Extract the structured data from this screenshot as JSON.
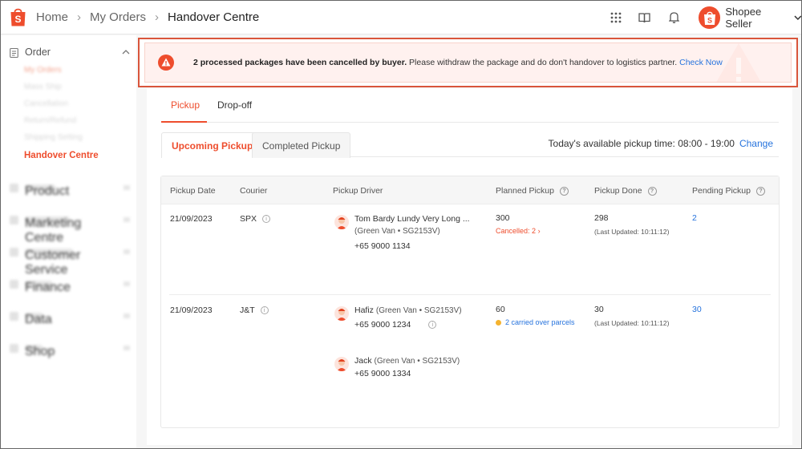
{
  "header": {
    "breadcrumbs": [
      "Home",
      "My Orders",
      "Handover Centre"
    ],
    "seller_name": "Shopee Seller",
    "icons": [
      "apps-grid-icon",
      "book-icon",
      "bell-icon",
      "chevron-down-icon"
    ]
  },
  "sidebar": {
    "section_label": "Order",
    "sub_items": [
      "My Orders",
      "Mass Ship",
      "Cancellation",
      "Return/Refund",
      "Shipping Setting"
    ],
    "active_item": "Handover Centre",
    "collapsed_groups": [
      "Product",
      "Marketing Centre",
      "Customer Service",
      "Finance",
      "Data",
      "Shop"
    ]
  },
  "alert": {
    "bold": "2 processed packages have been cancelled by buyer.",
    "text": " Please withdraw the package and do don't handover to logistics partner. ",
    "link": "Check Now"
  },
  "tabs": [
    "Pickup",
    "Drop-off"
  ],
  "subtabs": [
    "Upcoming Pickup",
    "Completed Pickup"
  ],
  "pickup_time": {
    "text": "Today's available pickup time: 08:00 - 19:00",
    "change": "Change"
  },
  "table": {
    "columns": [
      "Pickup Date",
      "Courier",
      "Pickup Driver",
      "Planned Pickup",
      "Pickup Done",
      "Pending Pickup"
    ],
    "rows": [
      {
        "date": "21/09/2023",
        "courier": "SPX",
        "driver1_name": "Tom Bardy Lundy Very Long ...",
        "driver1_vehicle": "(Green Van • SG2153V)",
        "driver1_phone": "+65 9000 1134",
        "planned": "300",
        "planned_note": "Cancelled: 2",
        "done": "298",
        "done_note": "(Last Updated: 10:11:12)",
        "pending": "2"
      },
      {
        "date": "21/09/2023",
        "courier": "J&T",
        "driver1_name": "Hafiz",
        "driver1_vehicle": "(Green Van • SG2153V)",
        "driver1_phone": "+65 9000 1234",
        "driver2_name": "Jack",
        "driver2_vehicle": "(Green Van • SG2153V)",
        "driver2_phone": "+65 9000 1334",
        "planned": "60",
        "planned_note": "2 carried over parcels",
        "done": "30",
        "done_note": "(Last Updated: 10:11:12)",
        "pending": "30"
      }
    ]
  },
  "colors": {
    "brand": "#ee4d2d",
    "link": "#2673dd",
    "alert_bg": "#fff1ef",
    "alert_outline": "#d9553b",
    "carry_over_dot": "#f5b32f"
  }
}
